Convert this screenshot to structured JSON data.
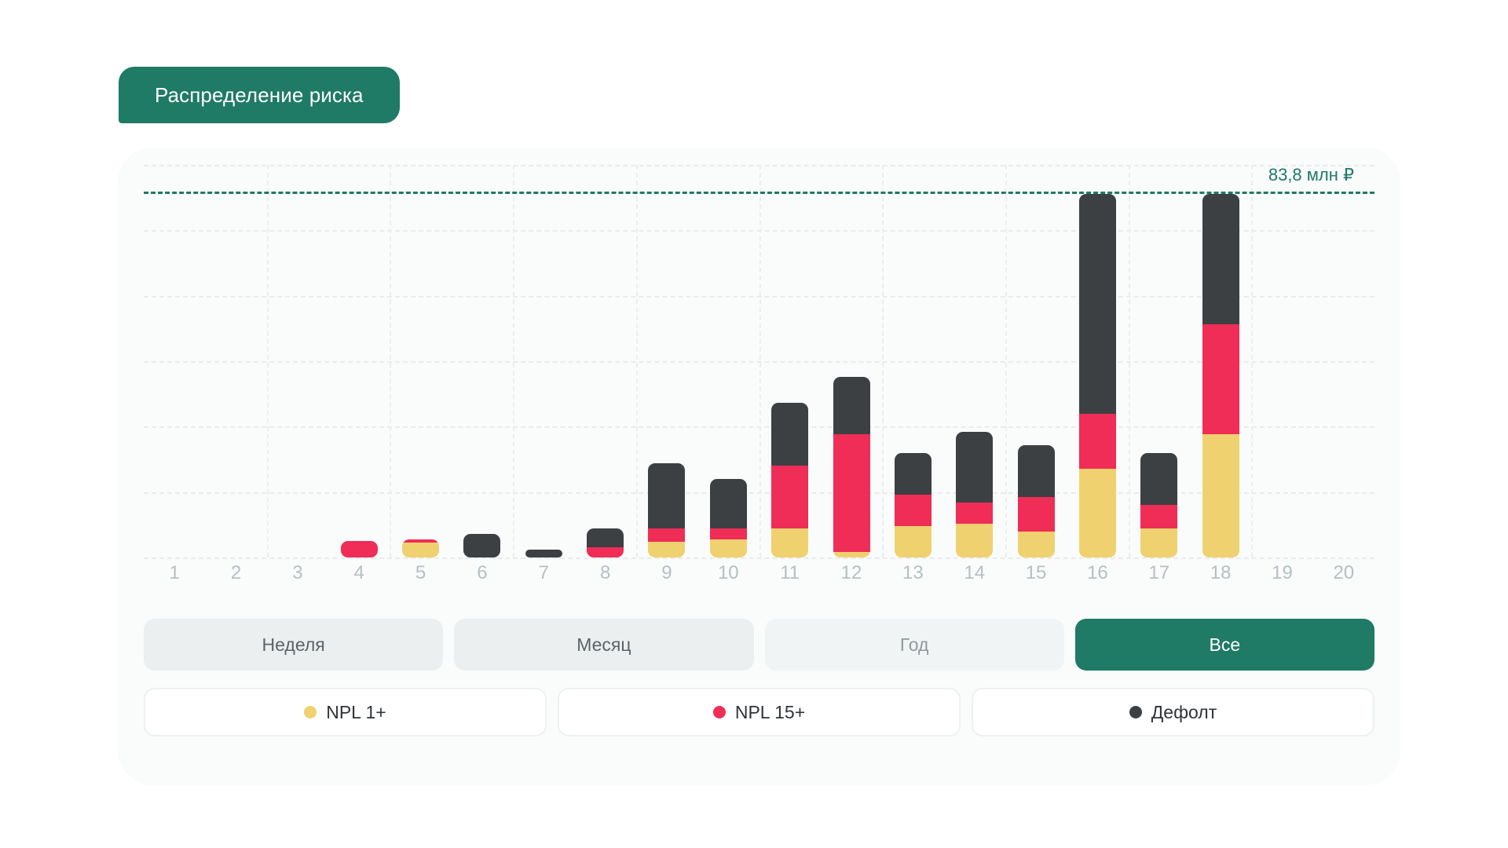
{
  "header": {
    "title": "Распределение риска",
    "accent_color": "#1f7a66"
  },
  "threshold": {
    "label": "83,8 млн ₽",
    "value": 83.8,
    "color": "#1f7a66"
  },
  "filters": {
    "items": [
      {
        "label": "Неделя",
        "active": false
      },
      {
        "label": "Месяц",
        "active": false
      },
      {
        "label": "Год",
        "active": false
      },
      {
        "label": "Все",
        "active": true
      }
    ]
  },
  "legend": {
    "items": [
      {
        "label": "NPL 1+",
        "color": "#f0d170"
      },
      {
        "label": "NPL 15+",
        "color": "#ef2d56"
      },
      {
        "label": "Дефолт",
        "color": "#3c4043"
      }
    ]
  },
  "chart_data": {
    "type": "bar",
    "stacked": true,
    "title": "Распределение риска",
    "xlabel": "",
    "ylabel": "",
    "ylim": [
      0,
      90
    ],
    "grid": true,
    "legend_position": "bottom",
    "annotations": [
      {
        "text": "83,8 млн ₽",
        "type": "threshold-line",
        "y": 83.8
      }
    ],
    "categories": [
      "1",
      "2",
      "3",
      "4",
      "5",
      "6",
      "7",
      "8",
      "9",
      "10",
      "11",
      "12",
      "13",
      "14",
      "15",
      "16",
      "17",
      "18",
      "19",
      "20"
    ],
    "series": [
      {
        "name": "NPL 1+",
        "color": "#f0d170",
        "values": [
          0,
          0,
          0,
          0,
          3.4,
          0,
          0,
          0,
          3.6,
          4.2,
          6.6,
          1.2,
          7.2,
          7.8,
          6.0,
          20.4,
          6.6,
          28.2,
          0,
          0
        ]
      },
      {
        "name": "NPL 15+",
        "color": "#ef2d56",
        "values": [
          0,
          0,
          0,
          3.8,
          0.8,
          0,
          0,
          2.4,
          3.0,
          2.4,
          14.4,
          27.0,
          7.2,
          4.8,
          7.8,
          12.6,
          5.4,
          25.2,
          0,
          0
        ]
      },
      {
        "name": "Дефолт",
        "color": "#3c4043",
        "values": [
          0,
          0,
          0,
          0,
          0,
          5.4,
          1.8,
          4.2,
          15.0,
          11.4,
          14.4,
          13.2,
          9.6,
          16.2,
          12.0,
          50.4,
          12.0,
          30.0,
          0,
          0
        ]
      }
    ],
    "totals": [
      0,
      0,
      0,
      3.8,
      4.2,
      5.4,
      1.8,
      6.6,
      21.6,
      18.0,
      35.4,
      41.4,
      24.0,
      28.8,
      25.8,
      83.4,
      24.0,
      83.4,
      0,
      0
    ]
  }
}
